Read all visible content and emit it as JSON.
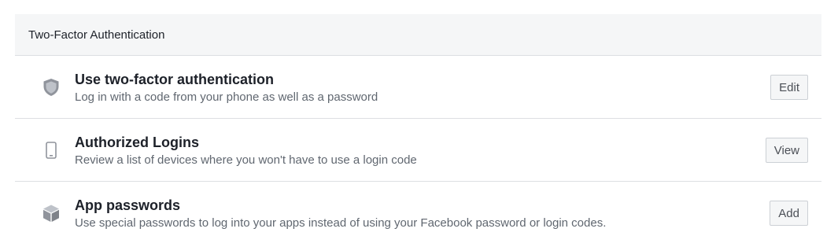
{
  "section": {
    "title": "Two-Factor Authentication"
  },
  "rows": [
    {
      "icon": "shield-icon",
      "title": "Use two-factor authentication",
      "description": "Log in with a code from your phone as well as a password",
      "button_label": "Edit"
    },
    {
      "icon": "phone-icon",
      "title": "Authorized Logins",
      "description": "Review a list of devices where you won't have to use a login code",
      "button_label": "View"
    },
    {
      "icon": "cube-icon",
      "title": "App passwords",
      "description": "Use special passwords to log into your apps instead of using your Facebook password or login codes.",
      "button_label": "Add"
    }
  ],
  "colors": {
    "header_bg": "#f5f6f7",
    "divider": "#dddfe2",
    "title_text": "#1d2129",
    "desc_text": "#606770",
    "icon": "#90949c"
  }
}
